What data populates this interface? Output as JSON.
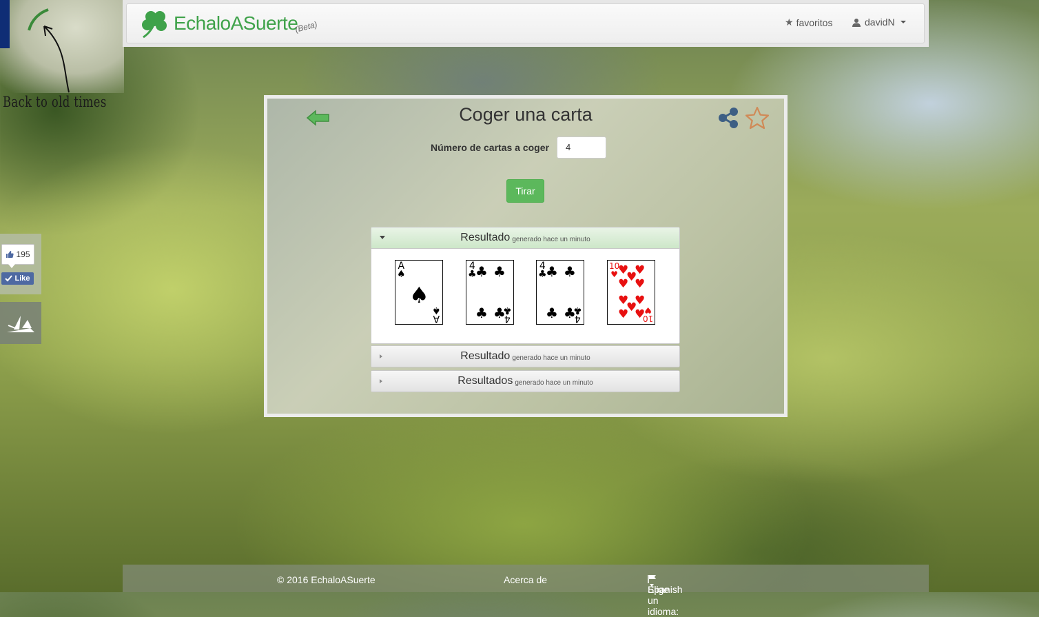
{
  "side": {
    "back_text": "Back to old times",
    "fb_count": "195",
    "fb_like": "Like"
  },
  "navbar": {
    "brand": "EchaloASuerte",
    "beta": "(Beta)",
    "favorites": "favoritos",
    "user": "davidN"
  },
  "page": {
    "title": "Coger una carta",
    "number_label": "Número de cartas a coger",
    "number_value": "4",
    "button": "Tirar"
  },
  "results": [
    {
      "heading": "Resultado",
      "sub": "generado hace un minuto",
      "expanded": true
    },
    {
      "heading": "Resultado",
      "sub": "generado hace un minuto",
      "expanded": false
    },
    {
      "heading": "Resultados",
      "sub": "generado hace un minuto",
      "expanded": false
    }
  ],
  "cards": [
    {
      "rank": "A",
      "suit": "♠",
      "name": "A of spades"
    },
    {
      "rank": "4",
      "suit": "♣",
      "name": "4 of clubs"
    },
    {
      "rank": "4",
      "suit": "♣",
      "name": "4 of clubs"
    },
    {
      "rank": "10",
      "suit": "♥",
      "name": "10 of hearts"
    }
  ],
  "footer": {
    "copyright": "© 2016 EchaloASuerte",
    "about": "Acerca de",
    "language_label": "Elige un idioma:",
    "language": "Spanish"
  },
  "colors": {
    "brand_green": "#3fa24a",
    "button_green": "#5cb85c",
    "share_blue": "#3d5f84",
    "star_orange": "#d08a57",
    "heart_red": "#e81010"
  }
}
